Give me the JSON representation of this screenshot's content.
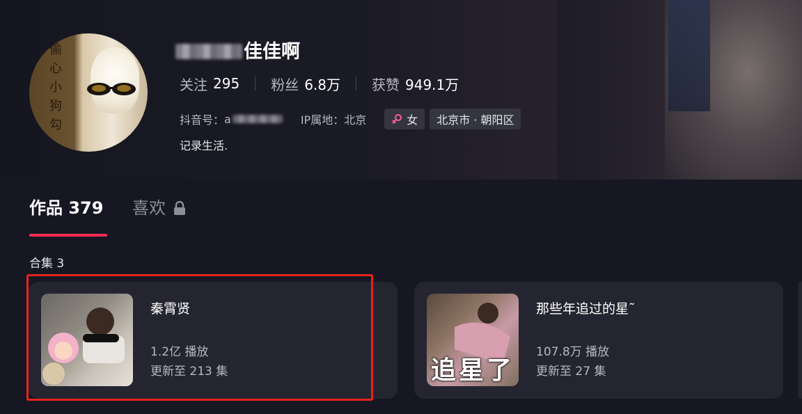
{
  "profile": {
    "username_suffix": "佳佳啊",
    "avatar_text": "偷心小狗勾",
    "stats": [
      {
        "label": "关注",
        "value": "295"
      },
      {
        "label": "粉丝",
        "value": "6.8万"
      },
      {
        "label": "获赞",
        "value": "949.1万"
      }
    ],
    "douyin_id_label": "抖音号：",
    "douyin_id_visible": "a",
    "ip_location": "IP属地：北京",
    "gender_tag": "女",
    "location_tag": "北京市 · 朝阳区",
    "bio": "记录生活."
  },
  "tabs": {
    "works_label": "作品 379",
    "likes_label": "喜欢"
  },
  "collections": {
    "heading": "合集 3",
    "items": [
      {
        "title": "秦霄贤",
        "plays": "1.2亿 播放",
        "updates": "更新至 213 集",
        "thumb_text": ""
      },
      {
        "title": "那些年追过的星˜",
        "plays": "107.8万 播放",
        "updates": "更新至 27 集",
        "thumb_text": "追星了"
      }
    ]
  },
  "colors": {
    "accent": "#fe2c55",
    "highlight_box": "#e8231c",
    "background": "#161722",
    "card": "#242531"
  },
  "icons": {
    "gender": "female-icon",
    "likes_tab": "lock-icon"
  }
}
